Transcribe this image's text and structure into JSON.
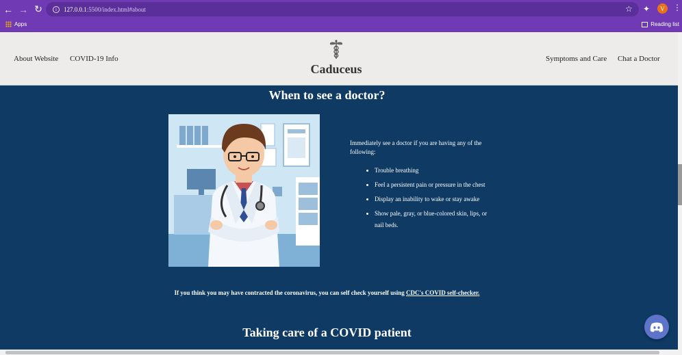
{
  "browser": {
    "url_host": "127.0.0.1",
    "url_path": ":5500/index.html#about",
    "profile_initial": "V",
    "bookmarks": {
      "apps_label": "Apps",
      "reading_list_label": "Reading list"
    }
  },
  "header": {
    "brand": "Caduceus",
    "nav_left": [
      "About Website",
      "COVID-19 Info"
    ],
    "nav_right": [
      "Symptoms and Care",
      "Chat a Doctor"
    ]
  },
  "main": {
    "section1_title": "When to see a doctor?",
    "intro": "Immediately see a doctor if you are having any of the following:",
    "symptoms": [
      "Trouble breathing",
      "Feel a persistent pain or pressure in the chest",
      "Display an inability to wake or stay awake",
      "Show pale, gray, or blue-colored skin, lips, or nail beds."
    ],
    "selfcheck_text": "If you think you may have contracted the coronavirus, you can self check yourself using ",
    "selfcheck_link": "CDC's COVID self-checker.",
    "section2_title": "Taking care of a COVID patient"
  },
  "colors": {
    "browser_chrome": "#6f3ab3",
    "page_bg": "#0e3a64",
    "header_bg": "#eeecea",
    "discord": "#5d74c9"
  }
}
